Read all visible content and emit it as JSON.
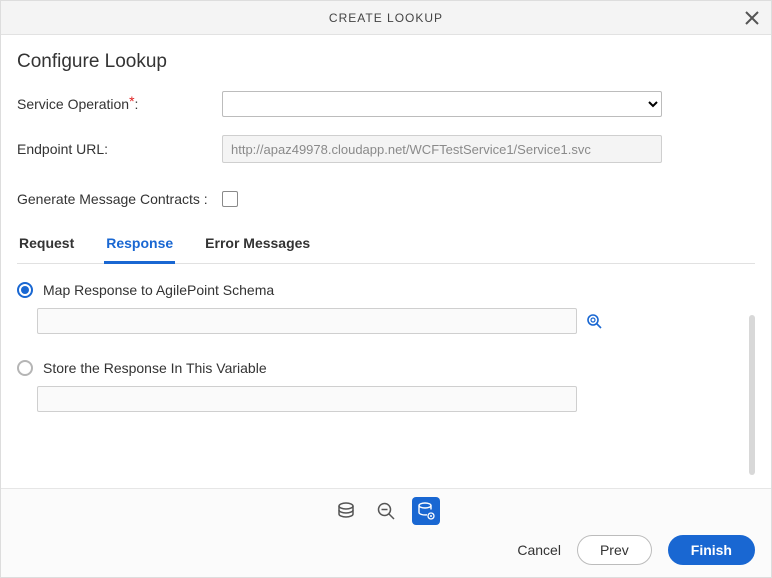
{
  "dialog": {
    "title": "CREATE LOOKUP"
  },
  "heading": "Configure Lookup",
  "fields": {
    "service_op": {
      "label": "Service Operation",
      "colon": ":"
    },
    "endpoint": {
      "label": "Endpoint URL:",
      "value": "http://apaz49978.cloudapp.net/WCFTestService1/Service1.svc"
    },
    "gen_contracts": {
      "label": "Generate Message Contracts :"
    }
  },
  "tabs": {
    "request": "Request",
    "response": "Response",
    "errors": "Error Messages"
  },
  "response": {
    "map_label": "Map Response to AgilePoint Schema",
    "store_label": "Store the Response In This Variable"
  },
  "footer": {
    "cancel": "Cancel",
    "prev": "Prev",
    "finish": "Finish"
  }
}
